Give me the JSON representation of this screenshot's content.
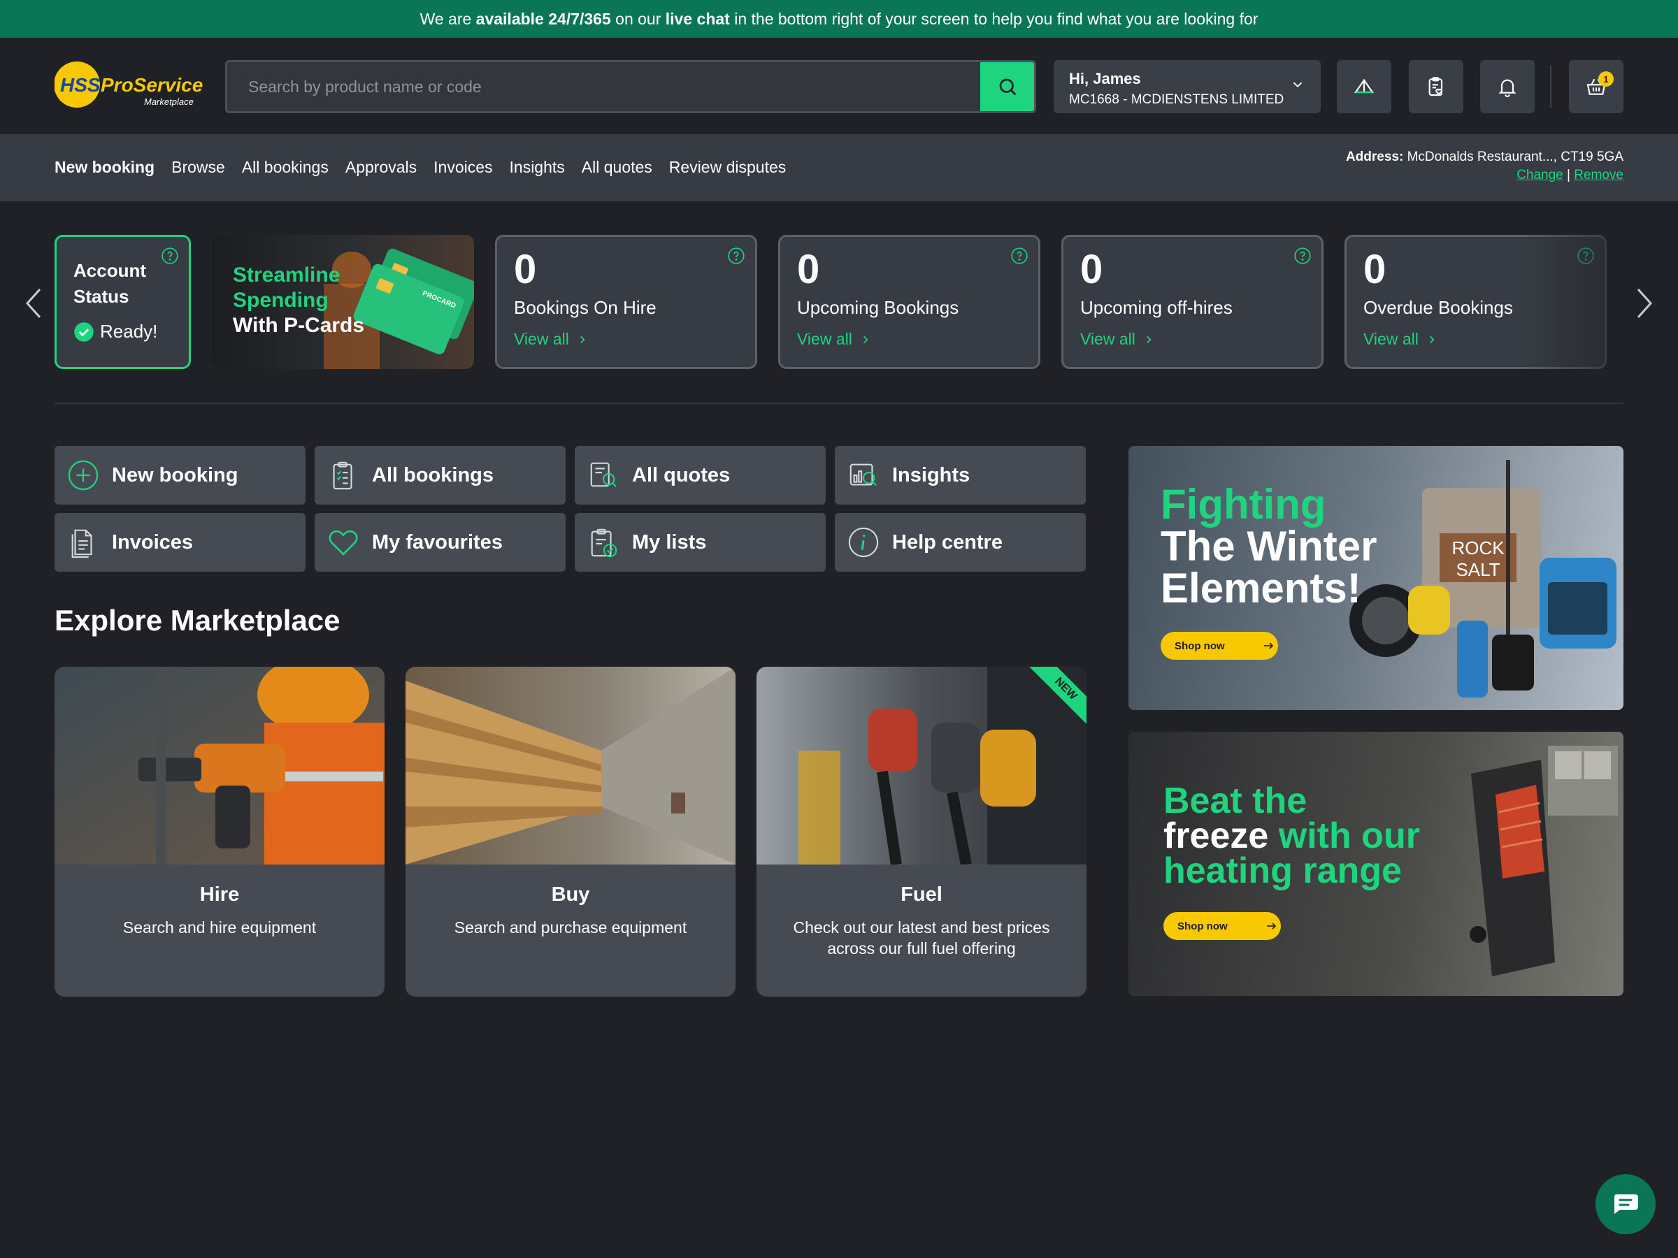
{
  "banner": {
    "pre": "We are ",
    "bold1": "available 24/7/365",
    "mid": " on our ",
    "bold2": "live chat",
    "post": " in the bottom right of your screen to help you find what you are looking for"
  },
  "header": {
    "logo": {
      "hss": "HSS",
      "pro": "ProService",
      "sub": "Marketplace"
    },
    "search_placeholder": "Search by product name or code",
    "account": {
      "greeting": "Hi, James",
      "company": "MC1668 - MCDIENSTENS LIMITED"
    },
    "cart_count": "1"
  },
  "nav": {
    "items": [
      {
        "label": "New booking",
        "active": true
      },
      {
        "label": "Browse"
      },
      {
        "label": "All bookings"
      },
      {
        "label": "Approvals"
      },
      {
        "label": "Invoices"
      },
      {
        "label": "Insights"
      },
      {
        "label": "All quotes"
      },
      {
        "label": "Review disputes"
      }
    ],
    "address_label": "Address:",
    "address_value": "McDonalds Restaurant..., CT19 5GA",
    "change": "Change",
    "separator": "|",
    "remove": "Remove"
  },
  "status": {
    "title": "Account Status",
    "value": "Ready!"
  },
  "promo": {
    "line1": "Streamline",
    "line2": "Spending",
    "line3": "With P-Cards",
    "card_brand": "PROCARD"
  },
  "stats": [
    {
      "number": "0",
      "label": "Bookings On Hire",
      "link": "View all"
    },
    {
      "number": "0",
      "label": "Upcoming Bookings",
      "link": "View all"
    },
    {
      "number": "0",
      "label": "Upcoming off-hires",
      "link": "View all"
    },
    {
      "number": "0",
      "label": "Overdue Bookings",
      "link": "View all"
    }
  ],
  "quick_links": [
    {
      "label": "New booking",
      "icon": "plus-circle-icon"
    },
    {
      "label": "All bookings",
      "icon": "clipboard-icon"
    },
    {
      "label": "All quotes",
      "icon": "quote-search-icon"
    },
    {
      "label": "Insights",
      "icon": "chart-search-icon"
    },
    {
      "label": "Invoices",
      "icon": "document-icon"
    },
    {
      "label": "My favourites",
      "icon": "heart-icon"
    },
    {
      "label": "My lists",
      "icon": "clipboard-check-icon"
    },
    {
      "label": "Help centre",
      "icon": "info-icon"
    }
  ],
  "explore": {
    "title": "Explore Marketplace",
    "cards": [
      {
        "title": "Hire",
        "subtitle": "Search and hire equipment"
      },
      {
        "title": "Buy",
        "subtitle": "Search and purchase equipment"
      },
      {
        "title": "Fuel",
        "subtitle": "Check out our latest and best prices across our full fuel offering",
        "badge": "NEW"
      }
    ]
  },
  "ads": [
    {
      "line1": "Fighting",
      "line2": "The Winter",
      "line3": "Elements!",
      "cta": "Shop now",
      "sign": "ROCK SALT"
    },
    {
      "line1": "Beat the",
      "line2a": "freeze",
      "line2b": " with our",
      "line3": "heating range",
      "cta": "Shop now"
    }
  ],
  "colors": {
    "accent": "#1ed47f",
    "banner": "#0a7656",
    "background": "#202126",
    "yellow": "#f9c900"
  }
}
